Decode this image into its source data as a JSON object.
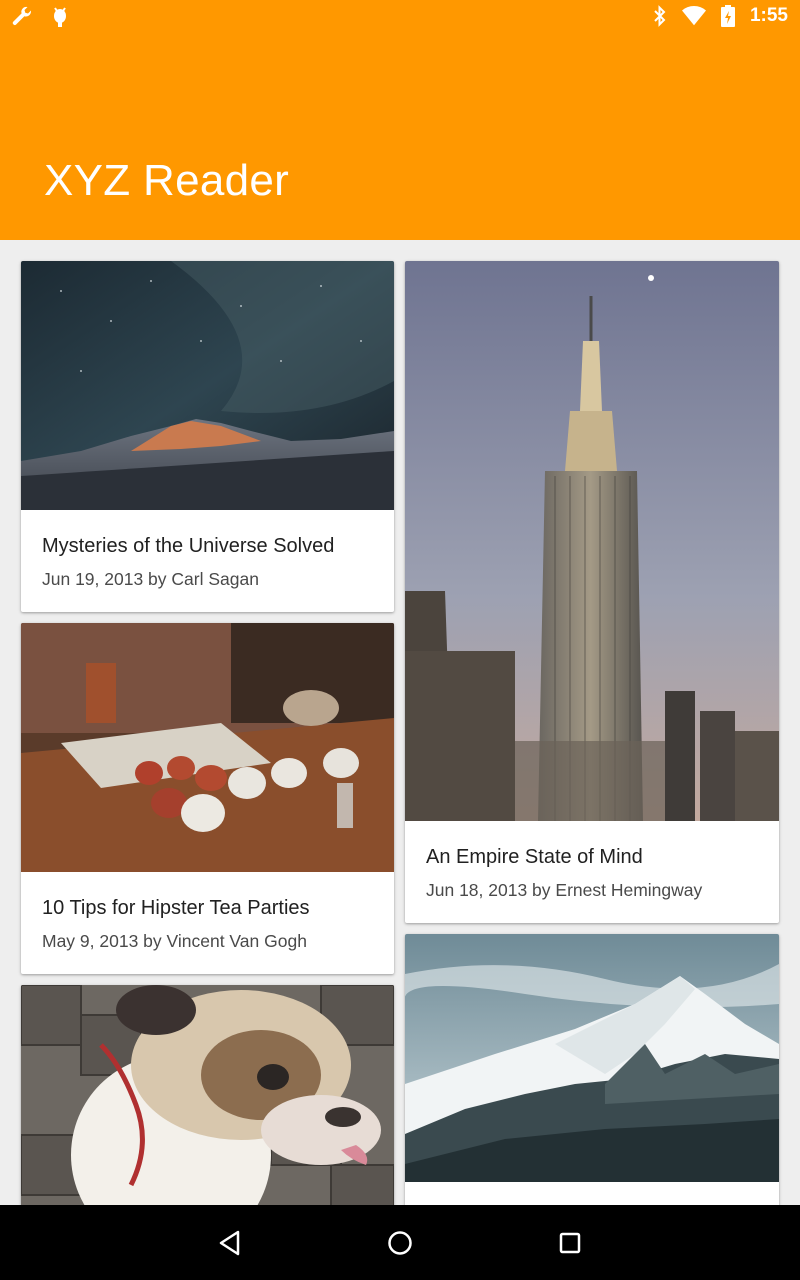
{
  "status_bar": {
    "time": "1:55",
    "left_icons": [
      "wrench-icon",
      "android-debug-icon"
    ],
    "right_icons": [
      "bluetooth-icon",
      "wifi-icon",
      "battery-charging-icon"
    ]
  },
  "app_bar": {
    "title": "XYZ Reader",
    "color": "#ff9800"
  },
  "articles": [
    {
      "title": "Mysteries of the Universe Solved",
      "subtitle": "Jun 19, 2013 by Carl Sagan",
      "image": "night-sky-mountain"
    },
    {
      "title": "An Empire State of Mind",
      "subtitle": "Jun 18, 2013 by Ernest Hemingway",
      "image": "empire-state-building"
    },
    {
      "title": "10 Tips for Hipster Tea Parties",
      "subtitle": "May 9, 2013 by Vincent Van Gogh",
      "image": "tea-cups-table"
    },
    {
      "title": "",
      "subtitle": "",
      "image": "snowy-mountain"
    },
    {
      "title": "",
      "subtitle": "",
      "image": "bulldog"
    }
  ],
  "nav_bar": {
    "buttons": [
      "back-icon",
      "home-icon",
      "recents-icon"
    ]
  }
}
